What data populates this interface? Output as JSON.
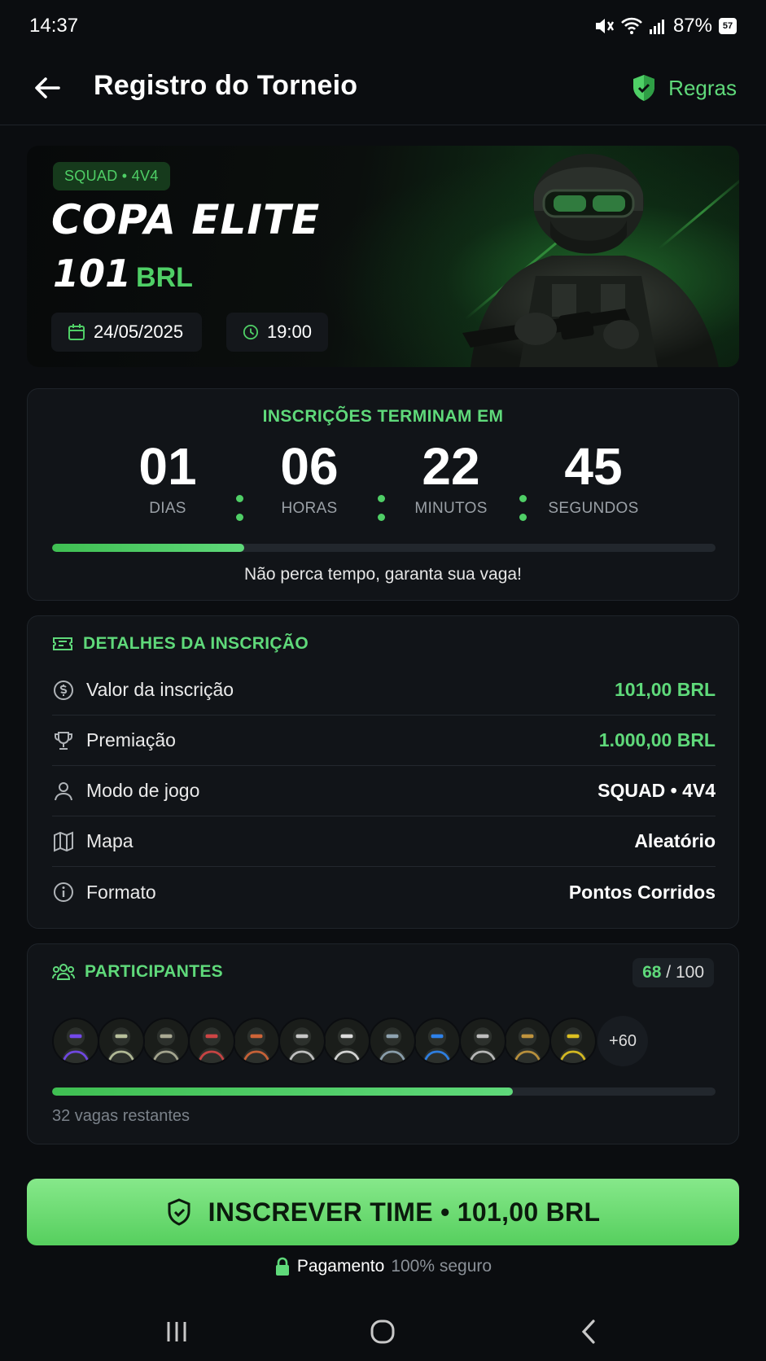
{
  "status_bar": {
    "time": "14:37",
    "battery": "87%",
    "battery_badge": "57"
  },
  "app_bar": {
    "title": "Registro do Torneio",
    "rules_label": "Regras"
  },
  "banner": {
    "mode_badge": "SQUAD • 4V4",
    "title": "COPA ELITE",
    "price_amount": "101",
    "price_currency": "BRL",
    "date": "24/05/2025",
    "time": "19:00"
  },
  "countdown": {
    "heading": "INSCRIÇÕES TERMINAM EM",
    "units": [
      {
        "value": "01",
        "label": "DIAS"
      },
      {
        "value": "06",
        "label": "HORAS"
      },
      {
        "value": "22",
        "label": "MINUTOS"
      },
      {
        "value": "45",
        "label": "SEGUNDOS"
      }
    ],
    "progress_fraction": 0.29,
    "message": "Não perca tempo, garanta sua vaga!"
  },
  "details": {
    "heading": "DETALHES DA INSCRIÇÃO",
    "rows": [
      {
        "icon": "dollar-circle-icon",
        "label": "Valor da inscrição",
        "value": "101,00 BRL",
        "highlight": true
      },
      {
        "icon": "trophy-icon",
        "label": "Premiação",
        "value": "1.000,00 BRL",
        "highlight": true
      },
      {
        "icon": "user-icon",
        "label": "Modo de jogo",
        "value": "SQUAD • 4V4",
        "highlight": false
      },
      {
        "icon": "map-icon",
        "label": "Mapa",
        "value": "Aleatório",
        "highlight": false
      },
      {
        "icon": "info-icon",
        "label": "Formato",
        "value": "Pontos Corridos",
        "highlight": false
      }
    ]
  },
  "participants": {
    "heading": "PARTICIPANTES",
    "count_current": "68",
    "count_total": " / 100",
    "more_label": "+60",
    "fill_fraction": 0.695,
    "slots_text": "32 vagas restantes",
    "avatar_colors": [
      "#7b4cff",
      "#c8d0a8",
      "#b8b8a0",
      "#e04848",
      "#e06a3a",
      "#d8d8d8",
      "#f0f0f0",
      "#9ab0c0",
      "#2f8cff",
      "#cfcfcf",
      "#d0a040",
      "#f0d020"
    ]
  },
  "cta": {
    "label": "INSCREVER TIME • 101,00 BRL"
  },
  "secure": {
    "label_a": "Pagamento",
    "label_b": "100% seguro"
  },
  "colors": {
    "accent": "#5fd97a",
    "background": "#0b0d10",
    "card": "#111418"
  }
}
